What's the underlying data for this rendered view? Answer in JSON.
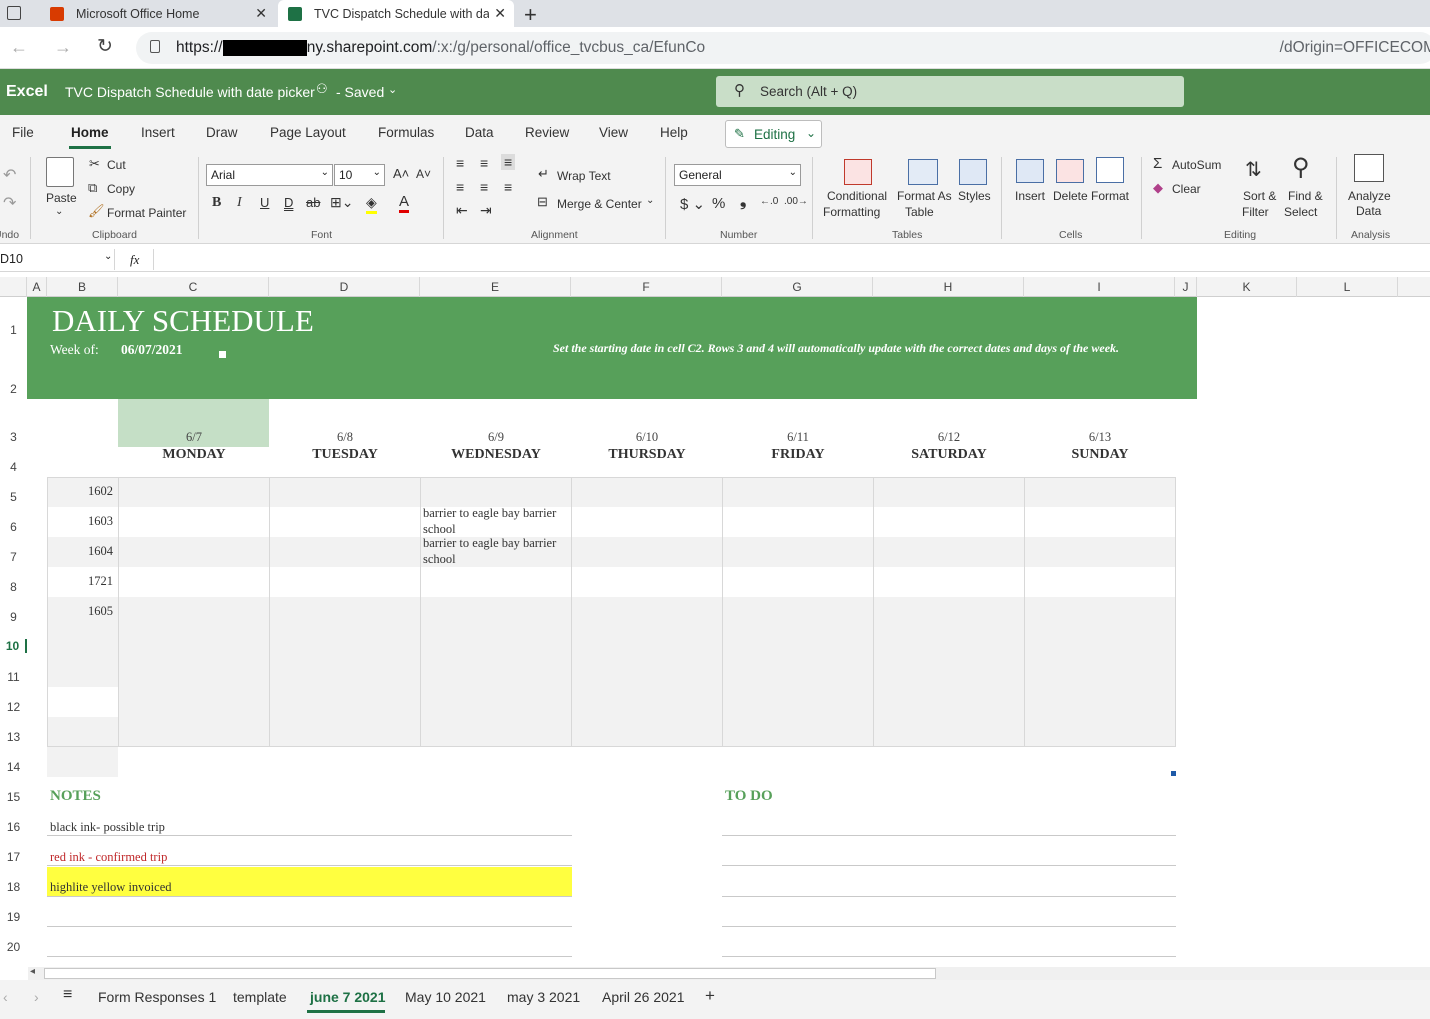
{
  "browser": {
    "tabs": [
      {
        "title": "Microsoft Office Home"
      },
      {
        "title": "TVC Dispatch Schedule with date"
      }
    ],
    "url_prefix": "https://",
    "url_domain": "ny.sharepoint.com",
    "url_path": "/:x:/g/personal/office_tvcbus_ca/EfunCo",
    "url_tail": "/dOrigin=OFFICECOM"
  },
  "excel": {
    "app": "Excel",
    "doc_title": "TVC Dispatch Schedule with date picker",
    "saved": "- Saved",
    "search_placeholder": "Search (Alt + Q)"
  },
  "menu": [
    "File",
    "Home",
    "Insert",
    "Draw",
    "Page Layout",
    "Formulas",
    "Data",
    "Review",
    "View",
    "Help"
  ],
  "editing_label": "Editing",
  "ribbon": {
    "undo": "Undo",
    "paste": "Paste",
    "cut": "Cut",
    "copy": "Copy",
    "format_painter": "Format Painter",
    "clipboard": "Clipboard",
    "font_name": "Arial",
    "font_size": "10",
    "font": "Font",
    "wrap_text": "Wrap Text",
    "merge_center": "Merge & Center",
    "alignment": "Alignment",
    "number_format": "General",
    "number": "Number",
    "cond_fmt_1": "Conditional",
    "cond_fmt_2": "Formatting",
    "fmt_table_1": "Format As",
    "fmt_table_2": "Table",
    "styles": "Styles",
    "tables": "Tables",
    "insert": "Insert",
    "delete": "Delete",
    "format": "Format",
    "cells": "Cells",
    "autosum": "AutoSum",
    "clear": "Clear",
    "sort_1": "Sort &",
    "sort_2": "Filter",
    "find_1": "Find &",
    "find_2": "Select",
    "editing": "Editing",
    "analyze_1": "Analyze",
    "analyze_2": "Data",
    "analysis": "Analysis"
  },
  "formula_bar": {
    "name_box": "D10",
    "fx": "fx",
    "value": ""
  },
  "columns": [
    "A",
    "B",
    "C",
    "D",
    "E",
    "F",
    "G",
    "H",
    "I",
    "J",
    "K",
    "L"
  ],
  "rows": [
    "1",
    "2",
    "3",
    "4",
    "5",
    "6",
    "7",
    "8",
    "9",
    "10",
    "11",
    "12",
    "13",
    "14",
    "15",
    "16",
    "17",
    "18",
    "19",
    "20"
  ],
  "sheet": {
    "title": "DAILY SCHEDULE",
    "week_label": "Week of:",
    "week_value": "06/07/2021",
    "instruction": "Set the starting date in cell C2. Rows 3 and 4 will automatically update with the correct dates and days of the week.",
    "days": [
      {
        "date": "6/7",
        "name": "MONDAY"
      },
      {
        "date": "6/8",
        "name": "TUESDAY"
      },
      {
        "date": "6/9",
        "name": "WEDNESDAY"
      },
      {
        "date": "6/10",
        "name": "THURSDAY"
      },
      {
        "date": "6/11",
        "name": "FRIDAY"
      },
      {
        "date": "6/12",
        "name": "SATURDAY"
      },
      {
        "date": "6/13",
        "name": "SUNDAY"
      }
    ],
    "buses": [
      "1602",
      "1603",
      "1604",
      "1721",
      "1605"
    ],
    "wed_row6_l1": "barrier to eagle bay barrier",
    "wed_row6_l2": "school",
    "wed_row7_l1": "barrier to eagle bay barrier",
    "wed_row7_l2": "school",
    "notes_title": "NOTES",
    "todo_title": "TO DO",
    "notes": [
      "black ink- possible trip",
      "red ink - confirmed trip",
      "highlite yellow invoiced"
    ],
    "accent": "#57a05a",
    "highlight": "#ffff40",
    "confirmed_color": "#c0282a"
  },
  "sheet_tabs": [
    "Form Responses 1",
    "template",
    "june 7 2021",
    "May 10 2021",
    "may 3 2021",
    "April 26 2021"
  ],
  "active_sheet": "june 7 2021"
}
